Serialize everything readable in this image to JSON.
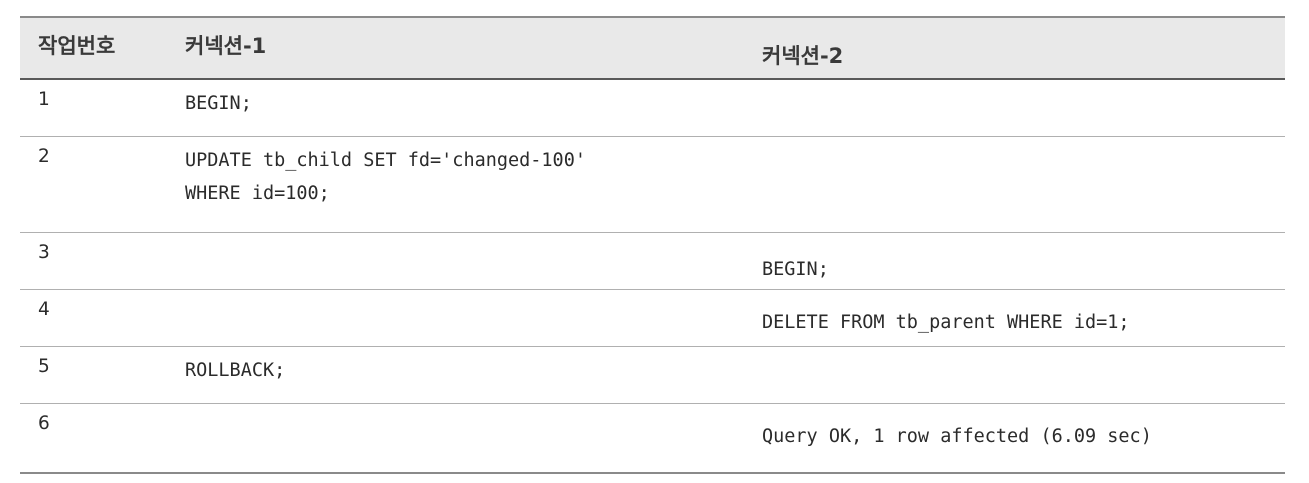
{
  "table": {
    "headers": [
      "작업번호",
      "커넥션-1",
      "커넥션-2"
    ],
    "rows": [
      {
        "step": "1",
        "conn1": [
          "BEGIN;"
        ],
        "conn2": [
          ""
        ]
      },
      {
        "step": "2",
        "conn1": [
          "UPDATE tb_child SET fd='changed-100'",
          "WHERE id=100;"
        ],
        "conn2": [
          ""
        ]
      },
      {
        "step": "3",
        "conn1": [
          ""
        ],
        "conn2": [
          "BEGIN;"
        ]
      },
      {
        "step": "4",
        "conn1": [
          ""
        ],
        "conn2": [
          "DELETE FROM tb_parent WHERE id=1;"
        ]
      },
      {
        "step": "5",
        "conn1": [
          "ROLLBACK;"
        ],
        "conn2": [
          ""
        ]
      },
      {
        "step": "6",
        "conn1": [
          ""
        ],
        "conn2": [
          "Query OK, 1 row affected (6.09 sec)"
        ]
      }
    ]
  }
}
